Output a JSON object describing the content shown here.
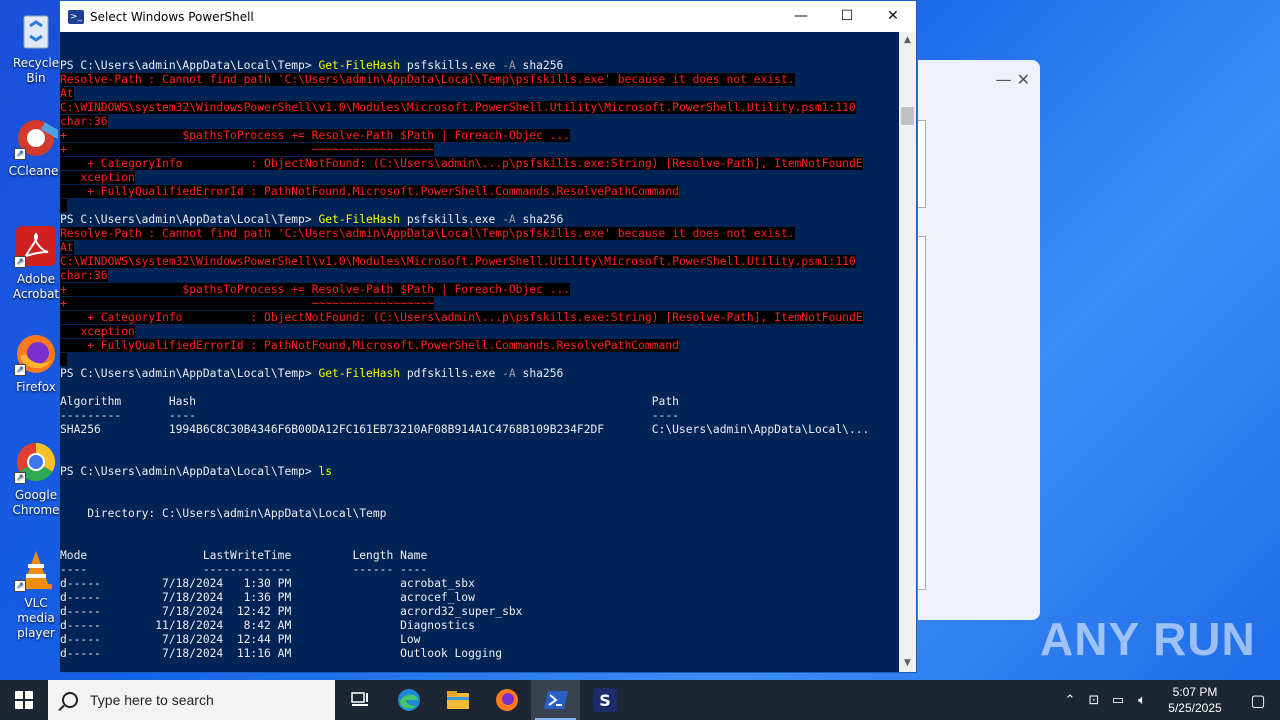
{
  "desktop": {
    "icons": [
      {
        "label": "Recycle Bin",
        "icon": "recycle-bin-icon"
      },
      {
        "label": "CCleaner",
        "icon": "ccleaner-icon"
      },
      {
        "label": "Adobe Acrobat",
        "icon": "adobe-acrobat-icon"
      },
      {
        "label": "Firefox",
        "icon": "firefox-icon"
      },
      {
        "label": "Google Chrome",
        "icon": "chrome-icon"
      },
      {
        "label": "VLC media player",
        "icon": "vlc-icon"
      }
    ],
    "watermark": "ANY RUN"
  },
  "window": {
    "title": "Select Windows PowerShell",
    "controls": {
      "minimize": "—",
      "maximize": "☐",
      "close": "✕"
    }
  },
  "console": {
    "lines": [
      {
        "type": "prompt",
        "prompt": "PS C:\\Users\\admin\\AppData\\Local\\Temp> ",
        "cmd": "Get-FileHash",
        "args": " psfskills.exe ",
        "param": "-A",
        "rest": " sha256"
      },
      {
        "type": "err",
        "text": "Resolve-Path : Cannot find path 'C:\\Users\\admin\\AppData\\Local\\Temp\\psfskills.exe' because it does not exist."
      },
      {
        "type": "err",
        "text": "At"
      },
      {
        "type": "err",
        "text": "C:\\WINDOWS\\system32\\WindowsPowerShell\\v1.0\\Modules\\Microsoft.PowerShell.Utility\\Microsoft.PowerShell.Utility.psm1:110"
      },
      {
        "type": "err",
        "text": "char:36"
      },
      {
        "type": "err",
        "text": "+                 $pathsToProcess += Resolve-Path $Path | Foreach-Objec ..."
      },
      {
        "type": "err",
        "text": "+                                    ~~~~~~~~~~~~~~~~~~"
      },
      {
        "type": "err",
        "text": "    + CategoryInfo          : ObjectNotFound: (C:\\Users\\admin\\...p\\psfskills.exe:String) [Resolve-Path], ItemNotFoundE"
      },
      {
        "type": "err",
        "text": "   xception"
      },
      {
        "type": "err",
        "text": "    + FullyQualifiedErrorId : PathNotFound,Microsoft.PowerShell.Commands.ResolvePathCommand"
      },
      {
        "type": "err",
        "text": " "
      },
      {
        "type": "prompt",
        "prompt": "PS C:\\Users\\admin\\AppData\\Local\\Temp> ",
        "cmd": "Get-FileHash",
        "args": " psfskills.exe ",
        "param": "-A",
        "rest": " sha256"
      },
      {
        "type": "err",
        "text": "Resolve-Path : Cannot find path 'C:\\Users\\admin\\AppData\\Local\\Temp\\psfskills.exe' because it does not exist."
      },
      {
        "type": "err",
        "text": "At"
      },
      {
        "type": "err",
        "text": "C:\\WINDOWS\\system32\\WindowsPowerShell\\v1.0\\Modules\\Microsoft.PowerShell.Utility\\Microsoft.PowerShell.Utility.psm1:110"
      },
      {
        "type": "err",
        "text": "char:36"
      },
      {
        "type": "err",
        "text": "+                 $pathsToProcess += Resolve-Path $Path | Foreach-Objec ..."
      },
      {
        "type": "err",
        "text": "+                                    ~~~~~~~~~~~~~~~~~~"
      },
      {
        "type": "err",
        "text": "    + CategoryInfo          : ObjectNotFound: (C:\\Users\\admin\\...p\\psfskills.exe:String) [Resolve-Path], ItemNotFoundE"
      },
      {
        "type": "err",
        "text": "   xception"
      },
      {
        "type": "err",
        "text": "    + FullyQualifiedErrorId : PathNotFound,Microsoft.PowerShell.Commands.ResolvePathCommand"
      },
      {
        "type": "err",
        "text": " "
      },
      {
        "type": "prompt",
        "prompt": "PS C:\\Users\\admin\\AppData\\Local\\Temp> ",
        "cmd": "Get-FileHash",
        "args": " pdfskills.exe ",
        "param": "-A",
        "rest": " sha256"
      },
      {
        "type": "out",
        "text": ""
      },
      {
        "type": "out",
        "text": "Algorithm       Hash                                                                   Path"
      },
      {
        "type": "out",
        "text": "---------       ----                                                                   ----"
      },
      {
        "type": "out",
        "text": "SHA256          1994B6C8C30B4346F6B00DA12FC161EB73210AF08B914A1C4768B109B234F2DF       C:\\Users\\admin\\AppData\\Local\\..."
      },
      {
        "type": "out",
        "text": ""
      },
      {
        "type": "out",
        "text": ""
      },
      {
        "type": "prompt",
        "prompt": "PS C:\\Users\\admin\\AppData\\Local\\Temp> ",
        "cmd": "ls",
        "args": "",
        "param": "",
        "rest": ""
      },
      {
        "type": "out",
        "text": ""
      },
      {
        "type": "out",
        "text": ""
      },
      {
        "type": "out",
        "text": "    Directory: C:\\Users\\admin\\AppData\\Local\\Temp"
      },
      {
        "type": "out",
        "text": ""
      },
      {
        "type": "out",
        "text": ""
      },
      {
        "type": "out",
        "text": "Mode                 LastWriteTime         Length Name"
      },
      {
        "type": "out",
        "text": "----                 -------------         ------ ----"
      },
      {
        "type": "out",
        "text": "d-----         7/18/2024   1:30 PM                acrobat_sbx"
      },
      {
        "type": "out",
        "text": "d-----         7/18/2024   1:36 PM                acrocef_low"
      },
      {
        "type": "out",
        "text": "d-----         7/18/2024  12:42 PM                acrord32_super_sbx"
      },
      {
        "type": "out",
        "text": "d-----        11/18/2024   8:42 AM                Diagnostics"
      },
      {
        "type": "out",
        "text": "d-----         7/18/2024  12:44 PM                Low"
      },
      {
        "type": "out",
        "text": "d-----         7/18/2024  11:16 AM                Outlook Logging"
      }
    ]
  },
  "taskbar": {
    "search_placeholder": "Type here to search",
    "apps": [
      "task-view-icon",
      "edge-icon",
      "file-explorer-icon",
      "firefox-icon",
      "powershell-icon",
      "app-s-icon"
    ],
    "time": "5:07 PM",
    "date": "5/25/2025"
  }
}
